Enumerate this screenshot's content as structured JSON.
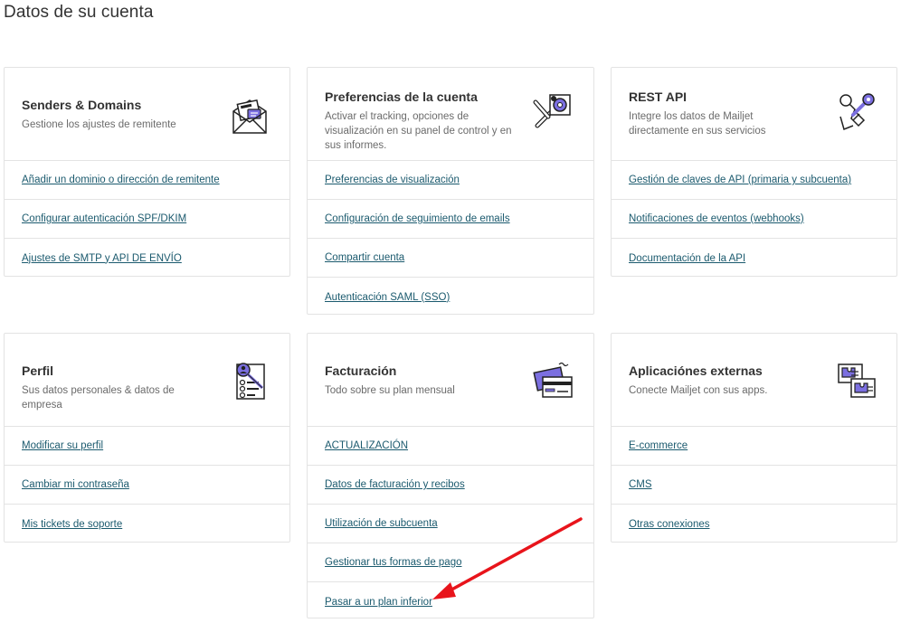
{
  "page": {
    "title": "Datos de su cuenta"
  },
  "cards": [
    {
      "title": "Senders & Domains",
      "desc": "Gestione los ajustes de remitente",
      "icon": "envelope-icon",
      "links": [
        "Añadir un dominio o dirección de remitente",
        "Configurar autenticación SPF/DKIM",
        "Ajustes de SMTP y API DE ENVÍO"
      ]
    },
    {
      "title": "Preferencias de la cuenta",
      "desc": "Activar el tracking, opciones de visualización en su panel de control y en sus informes.",
      "icon": "wrench-gear-icon",
      "links": [
        "Preferencias de visualización",
        "Configuración de seguimiento de emails",
        "Compartir cuenta",
        "Autenticación SAML (SSO)"
      ]
    },
    {
      "title": "REST API",
      "desc": "Integre los datos de Mailjet directamente en sus servicios",
      "icon": "keys-icon",
      "links": [
        "Gestión de claves de API (primaria y subcuenta)",
        "Notificaciones de eventos (webhooks)",
        "Documentación de la API"
      ]
    },
    {
      "title": "Perfil",
      "desc": "Sus datos personales & datos de empresa",
      "icon": "profile-document-icon",
      "links": [
        "Modificar su perfil",
        "Cambiar mi contraseña",
        "Mis tickets de soporte"
      ]
    },
    {
      "title": "Facturación",
      "desc": "Todo sobre su plan mensual",
      "icon": "credit-card-icon",
      "links": [
        "ACTUALIZACIÓN",
        "Datos de facturación y recibos",
        "Utilización de subcuenta",
        "Gestionar tus formas de pago",
        "Pasar a un plan inferior"
      ]
    },
    {
      "title": "Aplicaciónes externas",
      "desc": "Conecte Mailjet con sus apps.",
      "icon": "puzzle-apps-icon",
      "links": [
        "E-commerce",
        "CMS",
        "Otras conexiones"
      ]
    }
  ],
  "annotation": {
    "icon": "red-arrow-icon",
    "color": "#e8141b"
  }
}
